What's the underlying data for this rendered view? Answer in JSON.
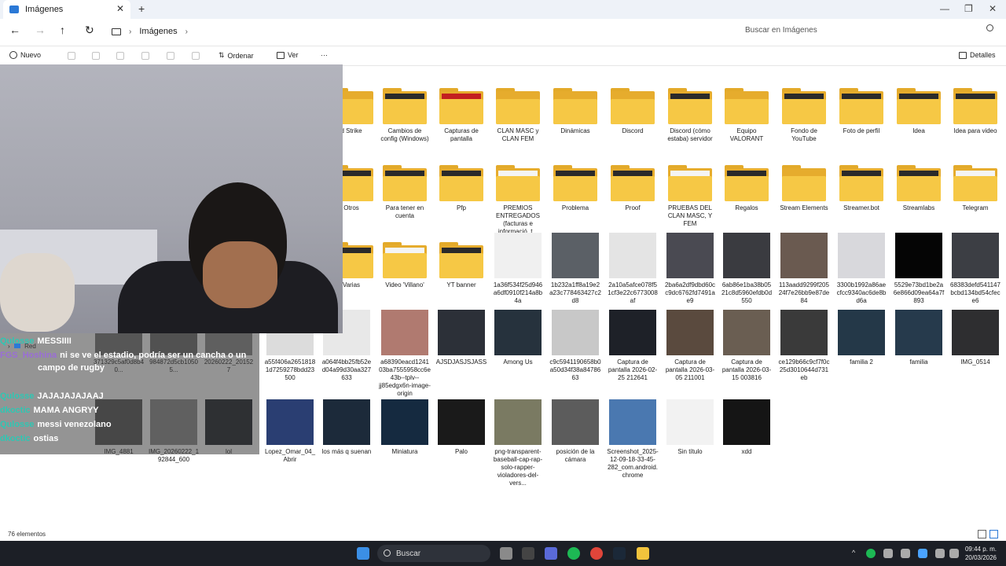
{
  "window": {
    "tab_title": "Imágenes",
    "tab_close": "✕",
    "new_tab": "+",
    "minimize": "—",
    "maximize": "❐",
    "close": "✕"
  },
  "nav": {
    "back": "←",
    "forward": "→",
    "up": "↑",
    "refresh": "↻",
    "crumb_sep": "›",
    "breadcrumb": "Imágenes",
    "search_placeholder": "Buscar en Imágenes"
  },
  "commands": {
    "new": "Nuevo",
    "sort": "Ordenar",
    "view": "Ver",
    "more": "···",
    "details": "Detalles"
  },
  "items": [
    {
      "label": "d Strike",
      "type": "folder",
      "paper": "none"
    },
    {
      "label": "Cambios de config (Windows)",
      "type": "folder",
      "paper": "dark"
    },
    {
      "label": "Capturas de pantalla",
      "type": "folder",
      "paper": "red"
    },
    {
      "label": "CLAN MASC y CLAN FEM",
      "type": "folder",
      "paper": "none"
    },
    {
      "label": "Dinámicas",
      "type": "folder",
      "paper": "none"
    },
    {
      "label": "Discord",
      "type": "folder",
      "paper": "none"
    },
    {
      "label": "Discord (cómo estaba) servidor",
      "type": "folder",
      "paper": "dark"
    },
    {
      "label": "Equipo VALORANT",
      "type": "folder",
      "paper": "none"
    },
    {
      "label": "Fondo de YouTube",
      "type": "folder",
      "paper": "dark"
    },
    {
      "label": "Foto de perfil",
      "type": "folder",
      "paper": "dark"
    },
    {
      "label": "Idea",
      "type": "folder",
      "paper": "dark"
    },
    {
      "label": "Idea para video",
      "type": "folder",
      "paper": "dark"
    },
    {
      "label": "Otros",
      "type": "folder",
      "paper": "dark"
    },
    {
      "label": "Para tener en cuenta",
      "type": "folder",
      "paper": "dark"
    },
    {
      "label": "Pfp",
      "type": "folder",
      "paper": "dark"
    },
    {
      "label": "PREMIOS ENTREGADOS (facturas e informació, t...",
      "type": "folder",
      "paper": "light"
    },
    {
      "label": "Problema",
      "type": "folder",
      "paper": "dark"
    },
    {
      "label": "Proof",
      "type": "folder",
      "paper": "dark"
    },
    {
      "label": "PRUEBAS DEL CLAN MASC, Y FEM",
      "type": "folder",
      "paper": "light"
    },
    {
      "label": "Regalos",
      "type": "folder",
      "paper": "dark"
    },
    {
      "label": "Stream Elements",
      "type": "folder",
      "paper": "none"
    },
    {
      "label": "Streamer.bot",
      "type": "folder",
      "paper": "dark"
    },
    {
      "label": "Streamlabs",
      "type": "folder",
      "paper": "dark"
    },
    {
      "label": "Telegram",
      "type": "folder",
      "paper": "light"
    },
    {
      "label": "Varias",
      "type": "folder",
      "paper": "dark"
    },
    {
      "label": "Video 'Villano'",
      "type": "folder",
      "paper": "light"
    },
    {
      "label": "YT banner",
      "type": "folder",
      "paper": "dark"
    },
    {
      "label": "1a36f534f25d946a6df0910f214a8b4a",
      "type": "image",
      "color": "#f0f0f0"
    },
    {
      "label": "1b232a1ff8a19e2a23c778463427c2d8",
      "type": "image",
      "color": "#5b6066"
    },
    {
      "label": "2a10a5afce078f51cf3e22c6773008af",
      "type": "image",
      "color": "#e4e4e4"
    },
    {
      "label": "2ba6a2df9dbd60cc9dc6762fd7491ae9",
      "type": "image",
      "color": "#4a4a52"
    },
    {
      "label": "6ab86e1ba38b0521c8d5960efdb0d550",
      "type": "image",
      "color": "#3a3b40"
    },
    {
      "label": "113aadd9299f20524f7e26bb9e87de84",
      "type": "image",
      "color": "#6a5a50"
    },
    {
      "label": "3300b1992a86aecfcc9340ac6de8bd6a",
      "type": "image",
      "color": "#d8d8dc"
    },
    {
      "label": "5529e73bd1be2a6e866d09ea64a7f893",
      "type": "image",
      "color": "#050505"
    },
    {
      "label": "68383defd541147bcbd134bd54cfece6",
      "type": "image",
      "color": "#3c3e44"
    },
    {
      "label": "371329c5af0d8b40...",
      "type": "image",
      "color": "#777777"
    },
    {
      "label": "984872d5cb10505...",
      "type": "image",
      "color": "#6a6a6a"
    },
    {
      "label": "20260222_201527",
      "type": "image",
      "color": "#8a8a8a"
    },
    {
      "label": "a55f406a26518181d7259278bdd23500",
      "type": "image",
      "color": "#dcdcdc"
    },
    {
      "label": "a064f4bb25fb52ed04a99d30aa327633",
      "type": "image",
      "color": "#e8e8e8"
    },
    {
      "label": "a68390eacd124103ba7555958cc6e43b--tplv--jj85edgx6n-image-origin",
      "type": "image",
      "color": "#b07a70"
    },
    {
      "label": "AJSDJASJSJASS",
      "type": "image",
      "color": "#2c3038"
    },
    {
      "label": "Among Us",
      "type": "image",
      "color": "#26323d"
    },
    {
      "label": "c9c5941190658b0a50d34f38a8478663",
      "type": "image",
      "color": "#c8c8c8"
    },
    {
      "label": "Captura de pantalla 2026-02-25 212641",
      "type": "image",
      "color": "#1e2128"
    },
    {
      "label": "Captura de pantalla 2026-03-05 211001",
      "type": "image",
      "color": "#5a4a3e"
    },
    {
      "label": "Captura de pantalla 2026-03-15 003816",
      "type": "image",
      "color": "#6a5e52"
    },
    {
      "label": "ce129b66c9cf7f0c25d3010644d731eb",
      "type": "image",
      "color": "#3a3a3a"
    },
    {
      "label": "familia 2",
      "type": "image",
      "color": "#243848"
    },
    {
      "label": "familia",
      "type": "image",
      "color": "#263a4c"
    },
    {
      "label": "IMG_0514",
      "type": "image",
      "color": "#2e2e30"
    },
    {
      "label": "IMG_4881",
      "type": "image",
      "color": "#555555"
    },
    {
      "label": "IMG_20260222_192844_600",
      "type": "image",
      "color": "#8c8c8c"
    },
    {
      "label": "lol",
      "type": "image",
      "color": "#1e2229"
    },
    {
      "label": "Lopez_Omar_04_Abrir",
      "type": "image",
      "color": "#2a3e72"
    },
    {
      "label": "los más q suenan",
      "type": "image",
      "color": "#1c2a3a"
    },
    {
      "label": "Miniatura",
      "type": "image",
      "color": "#152a40"
    },
    {
      "label": "Palo",
      "type": "image",
      "color": "#1a1a1a"
    },
    {
      "label": "png-transparent-baseball-cap-rap-solo-rapper-violadores-del-vers...",
      "type": "image",
      "color": "#7a7a62"
    },
    {
      "label": "posición de la cámara",
      "type": "image",
      "color": "#5c5c5c"
    },
    {
      "label": "Screenshot_2025-12-09-18-33-45-282_com.android.chrome",
      "type": "image",
      "color": "#4a78b0"
    },
    {
      "label": "Sin título",
      "type": "image",
      "color": "#f2f2f2"
    },
    {
      "label": "xdd",
      "type": "image",
      "color": "#151515"
    }
  ],
  "sidebar_tree": {
    "label": "Red",
    "chevron": "›"
  },
  "chat": [
    {
      "user": "Qulosse",
      "msg": "MESSIIII"
    },
    {
      "user": "FGS_Hoshina",
      "msg": "ni se ve el estadio, podría ser un cancha o un campo de rugby"
    },
    {
      "user": "Qulosse",
      "msg": "JAJAJAJAJAAJ"
    },
    {
      "user": "dkoctic",
      "msg": "MAMA ANGRYY"
    },
    {
      "user": "Qulosse",
      "msg": "messi venezolano"
    },
    {
      "user": "dkoctic",
      "msg": "ostias"
    }
  ],
  "status": {
    "count": "76 elementos"
  },
  "taskbar": {
    "search": "Buscar",
    "time": "09:44 p. m.",
    "date": "20/03/2026",
    "tray": "^"
  }
}
